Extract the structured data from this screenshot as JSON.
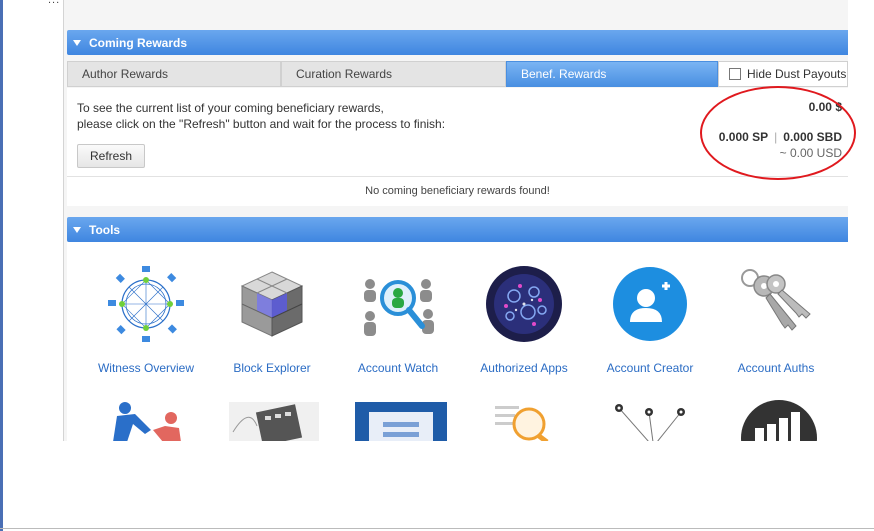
{
  "window": {
    "ellipsis": "..."
  },
  "coming_rewards": {
    "title": "Coming Rewards",
    "tabs": [
      {
        "label": "Author Rewards"
      },
      {
        "label": "Curation Rewards"
      },
      {
        "label": "Benef. Rewards"
      }
    ],
    "active_tab": "Benef. Rewards",
    "hide_dust_label": "Hide Dust Payouts",
    "message_line1": "To see the current list of your coming beneficiary rewards,",
    "message_line2": "please click on the \"Refresh\" button and wait for the process to finish:",
    "refresh_label": "Refresh",
    "total_usd": "0.00 $",
    "sp": "0.000 SP",
    "separator": "|",
    "sbd": "0.000 SBD",
    "usd_estimate": "~ 0.00 USD",
    "no_rewards": "No coming beneficiary rewards found!"
  },
  "tools": {
    "title": "Tools",
    "items": [
      {
        "label": "Witness Overview",
        "icon": "network-icon"
      },
      {
        "label": "Block Explorer",
        "icon": "cube-icon"
      },
      {
        "label": "Account Watch",
        "icon": "magnifier-people-icon"
      },
      {
        "label": "Authorized Apps",
        "icon": "globe-apps-icon"
      },
      {
        "label": "Account Creator",
        "icon": "add-user-icon"
      },
      {
        "label": "Account Auths",
        "icon": "keys-icon"
      }
    ]
  },
  "colors": {
    "header_blue": "#3f86e0",
    "link_blue": "#2b6cc4",
    "annotation_red": "#e0191e"
  }
}
